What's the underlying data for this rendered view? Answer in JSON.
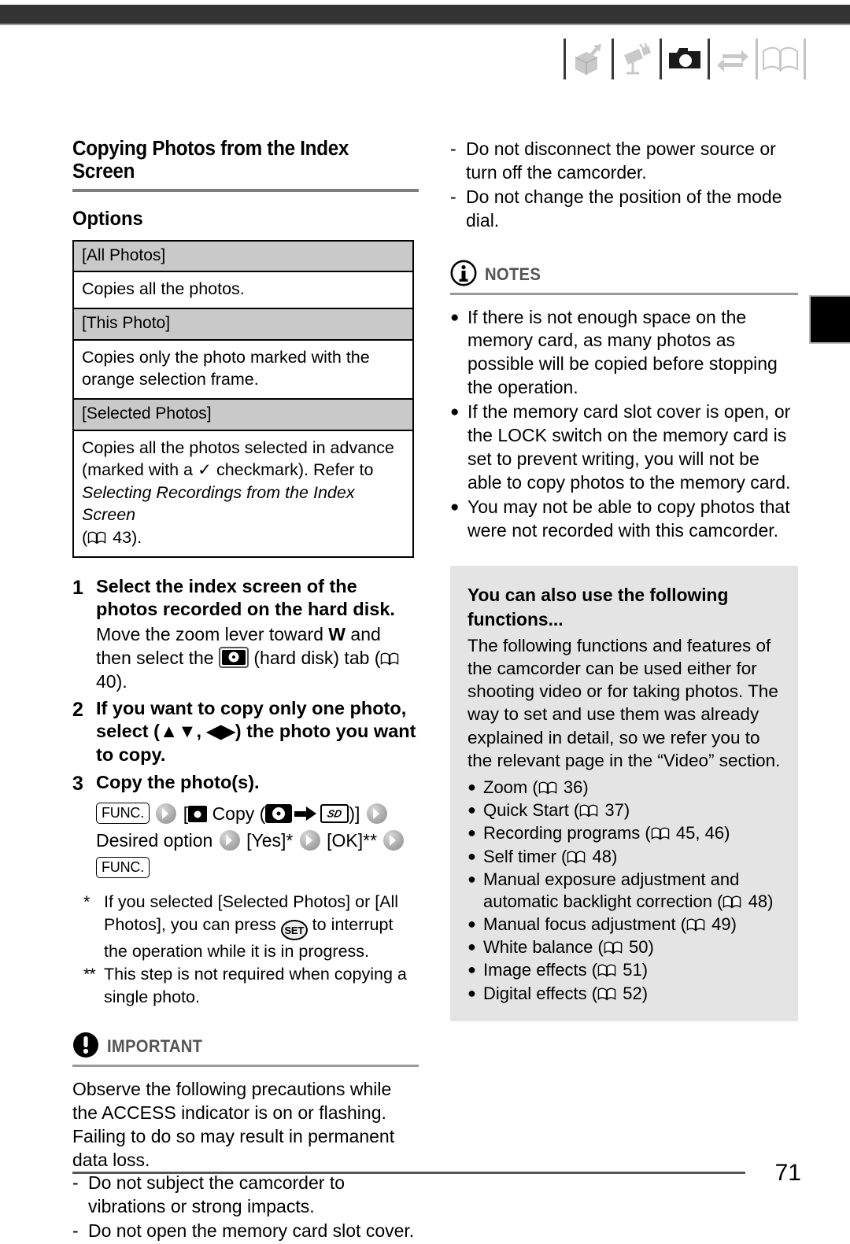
{
  "header": {
    "icons": [
      {
        "name": "unpack-box-icon",
        "state": "inactive"
      },
      {
        "name": "camcorder-icon",
        "state": "inactive"
      },
      {
        "name": "photo-camera-icon",
        "state": "active"
      },
      {
        "name": "transfer-arrows-icon",
        "state": "inactive"
      },
      {
        "name": "open-book-icon",
        "state": "outline"
      }
    ]
  },
  "left": {
    "section_title": "Copying Photos from the Index Screen",
    "options_title": "Options",
    "options_table": [
      {
        "label": "[All Photos]",
        "description": "Copies all the photos."
      },
      {
        "label": "[This Photo]",
        "description": "Copies only the photo marked with the orange selection frame."
      },
      {
        "label": "[Selected Photos]",
        "description_pre": "Copies all the photos selected in advance (marked with a ",
        "description_mid": " checkmark). Refer to ",
        "description_italic": "Selecting Recordings from the Index Screen",
        "description_page": "43",
        "description_post": ")."
      }
    ],
    "steps": [
      {
        "num": "1",
        "title": "Select the index screen of the photos recorded on the hard disk.",
        "text_pre": "Move the zoom lever toward ",
        "text_bold": "W",
        "text_mid": " and then select the ",
        "text_post": " (hard disk) tab (",
        "page": "40",
        "text_end": ")."
      },
      {
        "num": "2",
        "title": "If you want to copy only one photo, select (▲▼, ◀▶) the photo you want to copy."
      },
      {
        "num": "3",
        "title": "Copy the photo(s)."
      }
    ],
    "func_sequence": {
      "func_label": "FUNC.",
      "copy_label": "Copy",
      "bracket_open": "[",
      "bracket_close": ")]",
      "paren_open": "(",
      "desired_option": "Desired option",
      "yes_label": "[Yes]*",
      "ok_label": "[OK]**",
      "func_label_end": "FUNC."
    },
    "footnotes": [
      {
        "mark": "*",
        "text_pre": "If you selected [Selected Photos] or [All Photos], you can press ",
        "button": "SET",
        "text_post": " to interrupt the operation while it is in progress."
      },
      {
        "mark": "**",
        "text": "This step is not required when copying a single photo."
      }
    ],
    "important": {
      "label": "IMPORTANT",
      "paragraph": "Observe the following precautions while the ACCESS indicator is on or flashing. Failing to do so may result in permanent data loss.",
      "items": [
        "Do not subject the camcorder to vibrations or strong impacts.",
        "Do not open the memory card slot cover."
      ]
    }
  },
  "right": {
    "continued_items": [
      "Do not disconnect the power source or turn off the camcorder.",
      "Do not change the position of the mode dial."
    ],
    "notes": {
      "label": "NOTES",
      "items": [
        "If there is not enough space on the memory card, as many photos as possible will be copied before stopping the operation.",
        "If the memory card slot cover is open, or the LOCK switch on the memory card is set to prevent writing, you will not be able to copy photos to the memory card.",
        "You may not be able to copy photos that were not recorded with this camcorder."
      ]
    },
    "gray_box": {
      "title": "You can also use the following functions...",
      "paragraph": "The following functions and features of the camcorder can be used either for shooting video or for taking photos. The way to set and use them was already explained in detail, so we refer you to the relevant page in the “Video” section.",
      "functions": [
        {
          "label": "Zoom",
          "page": "36"
        },
        {
          "label": "Quick Start",
          "page": "37"
        },
        {
          "label": "Recording programs",
          "page": "45, 46"
        },
        {
          "label": "Self timer",
          "page": "48"
        },
        {
          "label": "Manual exposure adjustment and automatic backlight correction",
          "page": "48"
        },
        {
          "label": "Manual focus adjustment",
          "page": "49"
        },
        {
          "label": "White balance",
          "page": "50"
        },
        {
          "label": "Image effects",
          "page": "51"
        },
        {
          "label": "Digital effects",
          "page": "52"
        }
      ]
    }
  },
  "footer": {
    "page_number": "71"
  }
}
